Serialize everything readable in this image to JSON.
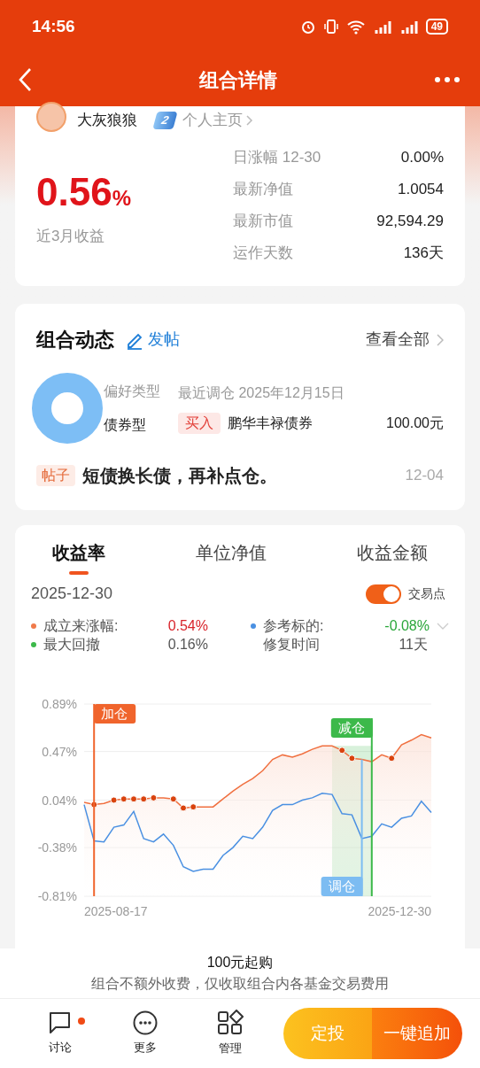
{
  "status_bar": {
    "time": "14:56",
    "battery": "49"
  },
  "nav": {
    "title": "组合详情"
  },
  "profile": {
    "name": "大灰狼狼",
    "level": "2",
    "homepage_link": "个人主页"
  },
  "summary": {
    "return_value": "0.56",
    "return_unit": "%",
    "return_label": "近3月收益",
    "stats": [
      {
        "label": "日涨幅 12-30",
        "value": "0.00%"
      },
      {
        "label": "最新净值",
        "value": "1.0054"
      },
      {
        "label": "最新市值",
        "value": "92,594.29"
      },
      {
        "label": "运作天数",
        "value": "136天"
      }
    ]
  },
  "activity": {
    "title": "组合动态",
    "post_button": "发帖",
    "view_all": "查看全部",
    "preference_label": "偏好类型",
    "preference_value": "债券型",
    "rebalance_label": "最近调仓 2025年12月15日",
    "trade": {
      "action": "买入",
      "fund": "鹏华丰禄债券",
      "amount": "100.00元"
    },
    "post": {
      "tag": "帖子",
      "text": "短债换长债，再补点仓。",
      "date": "12-04"
    }
  },
  "performance": {
    "tabs": [
      {
        "label": "收益率",
        "selected": true
      },
      {
        "label": "单位净值",
        "selected": false
      },
      {
        "label": "收益金额",
        "selected": false
      }
    ],
    "date": "2025-12-30",
    "toggle": {
      "label": "交易点",
      "on": true
    },
    "metrics": [
      {
        "label": "成立来涨幅:",
        "value": "0.54%",
        "color": "#f07a4a",
        "rising": true,
        "falling": false,
        "dropdown": false
      },
      {
        "label": "参考标的:",
        "value": "-0.08%",
        "color": "#4a90e2",
        "rising": false,
        "falling": true,
        "dropdown": true
      },
      {
        "label": "最大回撤",
        "value": "0.16%",
        "color": "#3cb94a",
        "rising": false,
        "falling": false,
        "dropdown": false
      },
      {
        "label": "修复时间",
        "value": "11天",
        "rising": false,
        "falling": false,
        "dropdown": false
      }
    ],
    "axis_start": "2025-08-17",
    "axis_end": "2025-12-30",
    "chart_data": {
      "type": "line",
      "ylim": [
        -0.81,
        0.89
      ],
      "yticks": [
        {
          "value": 0.89,
          "label": "0.89%"
        },
        {
          "value": 0.47,
          "label": "0.47%"
        },
        {
          "value": 0.04,
          "label": "0.04%"
        },
        {
          "value": -0.38,
          "label": "-0.38%"
        },
        {
          "value": -0.81,
          "label": "-0.81%"
        }
      ],
      "series": [
        {
          "color": "#f07040",
          "values": [
            0.02,
            0.0,
            0.01,
            0.04,
            0.05,
            0.05,
            0.05,
            0.06,
            0.06,
            0.05,
            -0.03,
            -0.02,
            -0.02,
            -0.02,
            0.05,
            0.12,
            0.18,
            0.23,
            0.3,
            0.4,
            0.44,
            0.42,
            0.45,
            0.49,
            0.52,
            0.52,
            0.48,
            0.41,
            0.4,
            0.38,
            0.44,
            0.41,
            0.53,
            0.57,
            0.62,
            0.59
          ]
        },
        {
          "color": "#4a90e2",
          "values": [
            0.0,
            -0.32,
            -0.33,
            -0.2,
            -0.18,
            -0.06,
            -0.3,
            -0.33,
            -0.26,
            -0.36,
            -0.55,
            -0.59,
            -0.57,
            -0.57,
            -0.45,
            -0.38,
            -0.28,
            -0.3,
            -0.2,
            -0.05,
            0.0,
            0.0,
            0.04,
            0.06,
            0.1,
            0.09,
            -0.08,
            -0.09,
            -0.3,
            -0.28,
            -0.17,
            -0.2,
            -0.12,
            -0.1,
            0.03,
            -0.07
          ]
        }
      ],
      "grid": true,
      "annotations": [
        "加仓",
        "减仓",
        "调仓"
      ]
    }
  },
  "purchase": {
    "min_amount": "100元起购",
    "fee_note": "组合不额外收费，仅收取组合内各基金交易费用"
  },
  "toolbar": {
    "items": [
      {
        "label": "讨论",
        "kind": "comment",
        "badge": true
      },
      {
        "label": "更多",
        "kind": "more",
        "badge": false
      },
      {
        "label": "管理",
        "kind": "manage",
        "badge": false
      }
    ],
    "buttons": [
      {
        "label": "定投",
        "kind": "secondary"
      },
      {
        "label": "一键追加",
        "kind": "primary"
      }
    ]
  }
}
